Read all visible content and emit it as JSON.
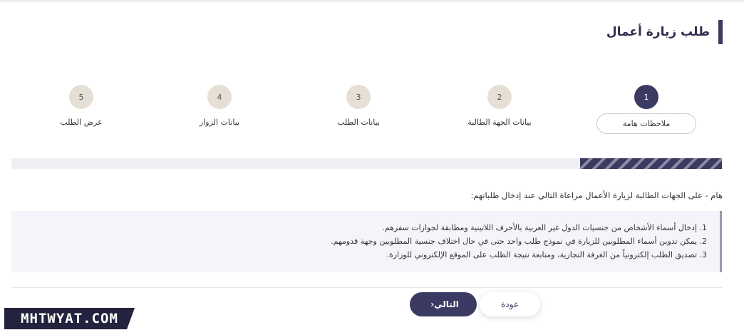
{
  "page": {
    "title": "طلب زيارة أعمال"
  },
  "steps": [
    {
      "number": "1",
      "label": "ملاحظات هامة",
      "active": true
    },
    {
      "number": "2",
      "label": "بيانات الجهة الطالبة",
      "active": false
    },
    {
      "number": "3",
      "label": "بيانات الطلب",
      "active": false
    },
    {
      "number": "4",
      "label": "بيانات الزوار",
      "active": false
    },
    {
      "number": "5",
      "label": "عرض الطلب",
      "active": false
    }
  ],
  "progress": {
    "percent": 20
  },
  "notice": {
    "title": "هام - على الجهات الطالبة لزيارة الأعمال مراعاة التالي عند إدخال طلباتهم:",
    "items": [
      "1. إدخال أسماء الأشخاص من جنسيات الدول غير العربية بالأحرف اللاتينية ومطابقة لجوازات سفرهم.",
      "2. يمكن تدوين أسماء المطلوبين للزيارة في نموذج طلب واحد حتى في حال اختلاف جنسية المطلوبين وجهة قدومهم.",
      "3. تصديق الطلب إلكترونياً من الغرفة التجارية، ومتابعة نتيجة الطلب على الموقع الإلكتروني للوزارة."
    ]
  },
  "buttons": {
    "back": "عودة",
    "next": "التالي",
    "next_icon": "›"
  },
  "watermark": "MHTWYAT.COM",
  "colors": {
    "primary": "#3a3a62",
    "step_inactive": "#e6dfd6",
    "notes_bg": "#f4f5fb"
  }
}
